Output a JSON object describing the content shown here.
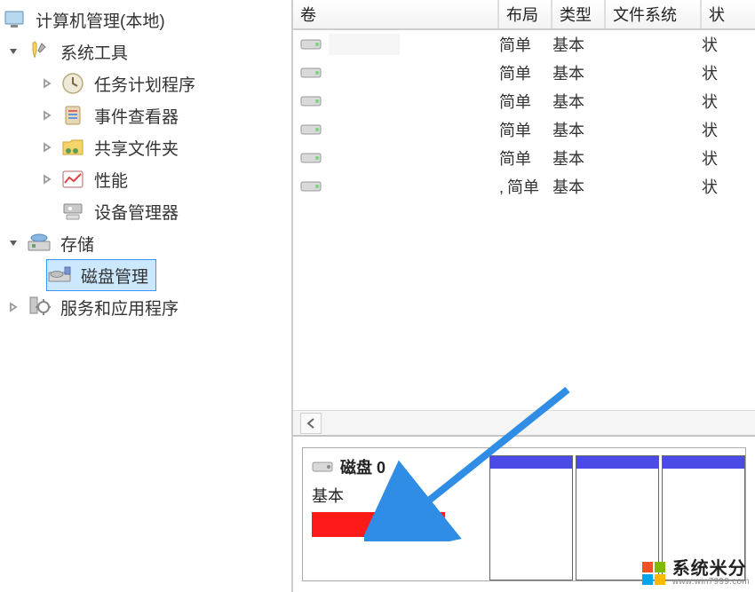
{
  "sidebar": {
    "root": "计算机管理(本地)",
    "system_tools": "系统工具",
    "task_scheduler": "任务计划程序",
    "event_viewer": "事件查看器",
    "shared_folders": "共享文件夹",
    "performance": "性能",
    "device_manager": "设备管理器",
    "storage": "存储",
    "disk_management": "磁盘管理",
    "services_apps": "服务和应用程序"
  },
  "table": {
    "headers": {
      "volume": "卷",
      "layout": "布局",
      "type": "类型",
      "fs": "文件系统",
      "status": "状"
    },
    "rows": [
      {
        "layout": "简单",
        "type": "基本",
        "status": "状"
      },
      {
        "layout": "简单",
        "type": "基本",
        "status": "状"
      },
      {
        "layout": "简单",
        "type": "基本",
        "status": "状"
      },
      {
        "layout": "简单",
        "type": "基本",
        "status": "状"
      },
      {
        "layout": "简单",
        "type": "基本",
        "status": "状"
      },
      {
        "layout": "简单",
        "type": "基本",
        "status": "状"
      }
    ]
  },
  "disk": {
    "title": "磁盘 0",
    "subtitle": "基本"
  },
  "watermark": {
    "title": "系统米分",
    "url": "www.win7999.com"
  }
}
